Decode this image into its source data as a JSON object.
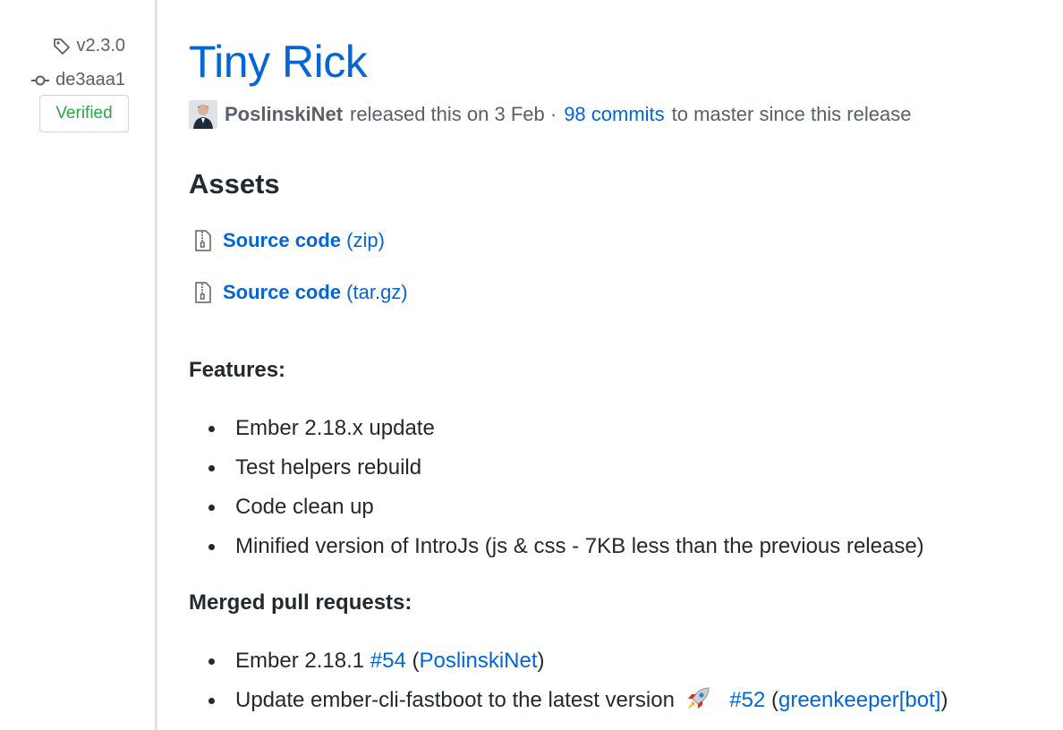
{
  "release": {
    "tag": "v2.3.0",
    "commit": "de3aaa1",
    "verified_label": "Verified",
    "title": "Tiny Rick",
    "author": "PoslinskiNet",
    "released_text": "released this on 3 Feb ·",
    "commits_link": "98 commits",
    "since_text": "to master since this release"
  },
  "assets": {
    "heading": "Assets",
    "items": [
      {
        "name": "Source code",
        "kind": "(zip)",
        "icon": "file-zip-icon"
      },
      {
        "name": "Source code",
        "kind": "(tar.gz)",
        "icon": "file-zip-icon"
      }
    ]
  },
  "features": {
    "heading": "Features:",
    "items": [
      "Ember 2.18.x update",
      "Test helpers rebuild",
      "Code clean up",
      "Minified version of IntroJs (js & css - 7KB less than the previous release)"
    ]
  },
  "merged": {
    "heading": "Merged pull requests:",
    "items": [
      {
        "text": "Ember 2.18.1",
        "pr": "#54",
        "open": "(",
        "user": "PoslinskiNet",
        "close": ")"
      },
      {
        "text": "Update ember-cli-fastboot to the latest version",
        "emoji": "rocket-emoji",
        "pr": "#52",
        "open": "(",
        "user": "greenkeeper[bot]",
        "close": ")"
      }
    ]
  },
  "colors": {
    "link": "#0366d6",
    "verified": "#28a745",
    "muted": "#586069",
    "text": "#24292e",
    "divider": "#e1e4e8"
  },
  "icons": [
    "tag-icon",
    "git-commit-icon",
    "avatar",
    "file-zip-icon",
    "rocket-emoji"
  ]
}
